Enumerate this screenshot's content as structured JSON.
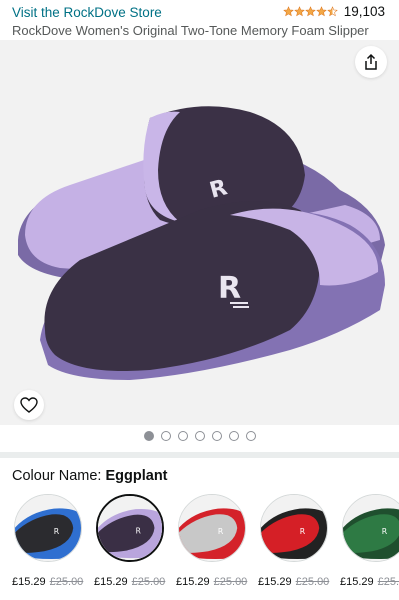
{
  "header": {
    "store_link": "Visit the RockDove Store",
    "rating_count": "19,103",
    "stars": 4.5,
    "title": "RockDove Women's Original Two-Tone Memory Foam Slipper"
  },
  "gallery": {
    "share_icon": "share-icon",
    "wishlist_icon": "heart-icon",
    "image_count": 7,
    "active_index": 0
  },
  "colour": {
    "label": "Colour Name: ",
    "value": "Eggplant"
  },
  "swatches": [
    {
      "name": "black-blue",
      "price": "£15.29",
      "was": "£25.00",
      "main": "#2b2b2f",
      "accent": "#2f6fd0",
      "selected": false
    },
    {
      "name": "eggplant",
      "price": "£15.29",
      "was": "£25.00",
      "main": "#3a2f45",
      "accent": "#b9a5dd",
      "selected": true
    },
    {
      "name": "grey-red",
      "price": "£15.29",
      "was": "£25.00",
      "main": "#c8c8c8",
      "accent": "#d4222a",
      "selected": false
    },
    {
      "name": "red-black",
      "price": "£15.29",
      "was": "£25.00",
      "main": "#d51f26",
      "accent": "#222222",
      "selected": false
    },
    {
      "name": "green",
      "price": "£15.29",
      "was": "£25.",
      "main": "#2e7a44",
      "accent": "#1f4f2e",
      "selected": false
    }
  ],
  "colors": {
    "link": "#007185",
    "star": "#f3a847"
  }
}
